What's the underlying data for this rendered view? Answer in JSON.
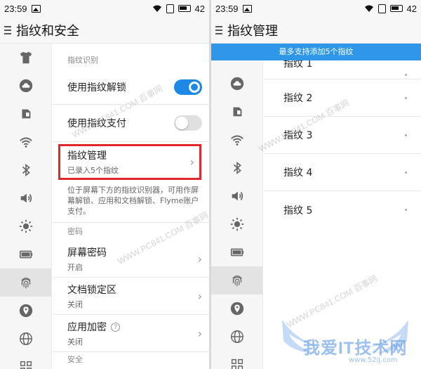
{
  "left": {
    "status": {
      "time": "23:59",
      "battery": "42"
    },
    "title": "指纹和安全",
    "section_fingerprint": "指纹识别",
    "unlock_label": "使用指纹解锁",
    "pay_label": "使用指纹支付",
    "manage_label": "指纹管理",
    "manage_sub": "已录入5个指纹",
    "description": "位于屏幕下方的指纹识别器，可用作屏幕解锁、应用和文档解锁、Flyme账户支付。",
    "section_password": "密码",
    "screen_pw_label": "屏幕密码",
    "screen_pw_sub": "开启",
    "doc_lock_label": "文档锁定区",
    "doc_lock_sub": "关闭",
    "app_enc_label": "应用加密",
    "app_enc_sub": "关闭",
    "help_glyph": "?",
    "section_security": "安全"
  },
  "right": {
    "status": {
      "time": "23:59",
      "battery": "42"
    },
    "title": "指纹管理",
    "banner": "最多支持添加5个指纹",
    "items": [
      "指纹 1",
      "指纹 2",
      "指纹 3",
      "指纹 4",
      "指纹 5"
    ]
  },
  "toggles": {
    "unlock": true,
    "pay": false
  },
  "sidebar_icons": [
    "shirt-icon",
    "cloud-icon",
    "sim-icon",
    "wifi-icon",
    "bluetooth-icon",
    "speaker-icon",
    "brightness-icon",
    "battery-icon",
    "fingerprint-icon",
    "location-icon",
    "globe-icon",
    "grid-icon"
  ],
  "watermarks": {
    "site": "WWW.PC841.COM 百事网",
    "logo_main": "我爱IT技术网",
    "logo_url": "www.52ij.com"
  },
  "colors": {
    "accent": "#1e88e5",
    "banner": "#2f97e8",
    "highlight": "#e3262b"
  }
}
